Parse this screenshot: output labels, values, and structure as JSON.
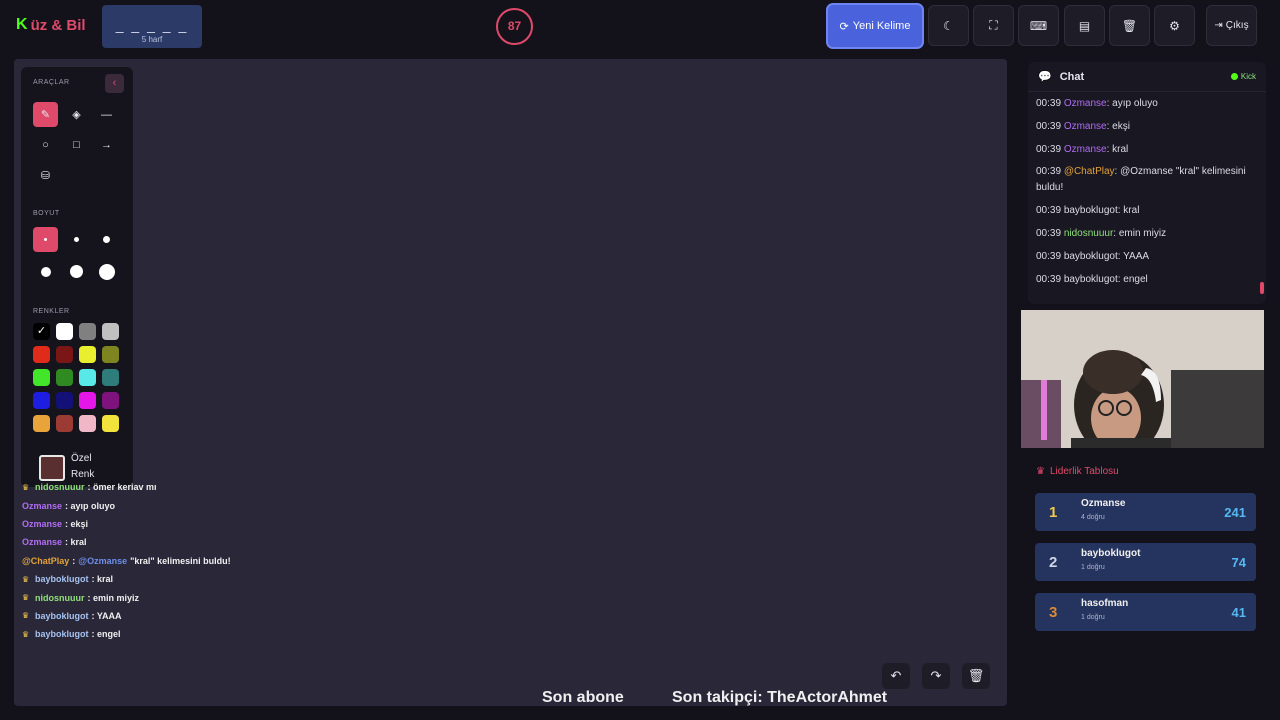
{
  "app": {
    "logo_k": "K",
    "logo_rest": "üz & Bil"
  },
  "word": {
    "mask": "_ _ _ _ _",
    "count": "5 harf"
  },
  "timer": {
    "value": "87"
  },
  "topbar": {
    "new_word_label": "Yeni Kelime",
    "logout_label": "Çıkış",
    "icons": [
      "moon-icon",
      "fullscreen-icon",
      "keyboard-icon",
      "archive-icon",
      "trash-icon",
      "gear-icon"
    ]
  },
  "tools": {
    "title": "ARAÇLAR",
    "size_title": "BOYUT",
    "colors_title": "RENKLER",
    "custom_color_label_1": "Özel",
    "custom_color_label_2": "Renk",
    "swatches": [
      "#000000",
      "#ffffff",
      "#808080",
      "#c0c0c0",
      "#e02a1a",
      "#7a1616",
      "#e9ef2e",
      "#7e8420",
      "#43e52b",
      "#2f8a22",
      "#58e8e8",
      "#2e7d7a",
      "#1d1ee0",
      "#131077",
      "#e416e8",
      "#7e137e",
      "#e8a43a",
      "#9c3b33",
      "#f0b8c6",
      "#f2e23c"
    ],
    "custom_color": "#5a2f2f",
    "accent": "#e04a6a"
  },
  "overlay_chat": [
    {
      "crown": true,
      "user": "nidosnuuur",
      "color": "green",
      "text": ": ömer keriav mı"
    },
    {
      "crown": false,
      "user": "Ozmanse",
      "color": "purple",
      "text": ": ayıp oluyo"
    },
    {
      "crown": false,
      "user": "Ozmanse",
      "color": "purple",
      "text": ": ekşi"
    },
    {
      "crown": false,
      "user": "Ozmanse",
      "color": "purple",
      "text": ": kral"
    },
    {
      "crown": false,
      "user": "@ChatPlay",
      "color": "gold",
      "mention": "@Ozmanse",
      "text": "\"kral\" kelimesini buldu!"
    },
    {
      "crown": true,
      "user": "bayboklugot",
      "color": "blue",
      "text": ": kral"
    },
    {
      "crown": true,
      "user": "nidosnuuur",
      "color": "green",
      "text": ": emin miyiz"
    },
    {
      "crown": true,
      "user": "bayboklugot",
      "color": "blue",
      "text": ": YAAA"
    },
    {
      "crown": true,
      "user": "bayboklugot",
      "color": "blue",
      "text": ": engel"
    }
  ],
  "ticker": {
    "subscriber": "Son abone",
    "follower": "Son takipçi: TheActorAhmet"
  },
  "chat": {
    "title": "Chat",
    "platform": "Kick",
    "messages": [
      {
        "time": "00:39",
        "user": "Ozmanse",
        "color": "purple",
        "text": ": ayıp oluyo"
      },
      {
        "time": "00:39",
        "user": "Ozmanse",
        "color": "purple",
        "text": ": ekşi"
      },
      {
        "time": "00:39",
        "user": "Ozmanse",
        "color": "purple",
        "text": ": kral"
      },
      {
        "time": "00:39",
        "user": "@ChatPlay",
        "color": "gold",
        "text": ": @Ozmanse \"kral\" kelimesini buldu!"
      },
      {
        "time": "00:39",
        "user": "bayboklugot",
        "color": "default",
        "text": ": kral"
      },
      {
        "time": "00:39",
        "user": "nidosnuuur",
        "color": "green",
        "text": ": emin miyiz"
      },
      {
        "time": "00:39",
        "user": "bayboklugot",
        "color": "default",
        "text": ": YAAA"
      },
      {
        "time": "00:39",
        "user": "bayboklugot",
        "color": "default",
        "text": ": engel"
      }
    ]
  },
  "leaderboard": {
    "title": "Liderlik Tablosu",
    "entries": [
      {
        "rank": "1",
        "name": "Ozmanse",
        "sub": "4 doğru",
        "score": "241",
        "rank_color": "#f2c94c"
      },
      {
        "rank": "2",
        "name": "bayboklugot",
        "sub": "1 doğru",
        "score": "74",
        "rank_color": "#cfd6e6"
      },
      {
        "rank": "3",
        "name": "hasofman",
        "sub": "1 doğru",
        "score": "41",
        "rank_color": "#d98a3a"
      }
    ]
  }
}
